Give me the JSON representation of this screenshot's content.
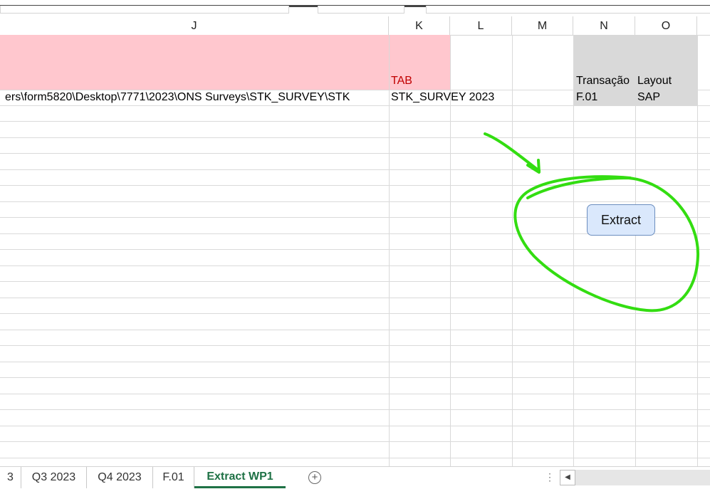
{
  "columns": [
    "J",
    "K",
    "L",
    "M",
    "N",
    "O"
  ],
  "cells": {
    "k_header": "TAB",
    "n_header": "Transação",
    "o_header": "Layout",
    "path_value": "ers\\form5820\\Desktop\\7771\\2023\\ONS Surveys\\STK_SURVEY\\STK",
    "k_value": "STK_SURVEY 2023",
    "n_value": "F.01",
    "o_value": "SAP"
  },
  "extract_button": {
    "label": "Extract"
  },
  "sheet_tabs": [
    {
      "label": "3"
    },
    {
      "label": "Q3 2023"
    },
    {
      "label": "Q4 2023"
    },
    {
      "label": "F.01"
    },
    {
      "label": "Extract WP1",
      "active": true
    }
  ],
  "add_sheet": "+",
  "sheet_dots": "⋮",
  "scroll_left": "◀",
  "colors": {
    "pink_fill": "#ffc7ce",
    "gray_fill": "#d9d9d9",
    "tab_red": "#c00000",
    "button_fill": "#dae8fc",
    "active_tab": "#1e7145",
    "annotation_green": "#33dd11"
  }
}
